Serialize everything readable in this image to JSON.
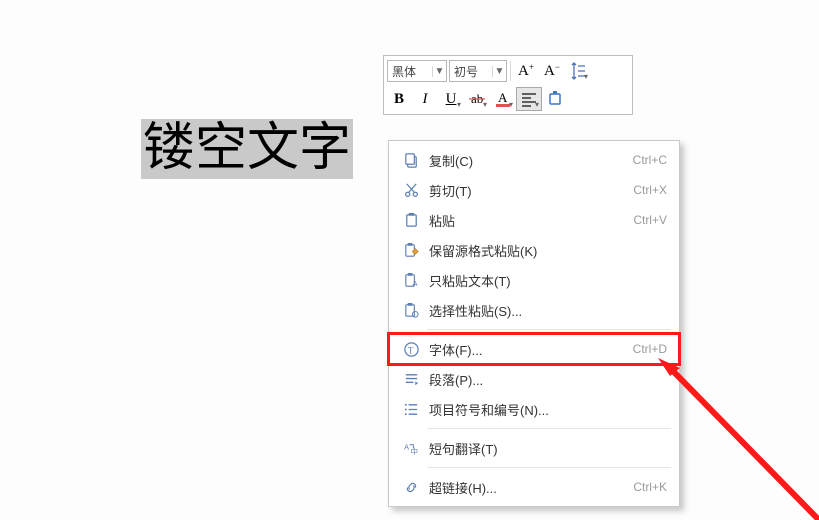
{
  "document": {
    "selected_text": "镂空文字"
  },
  "toolbar": {
    "font_name": "黑体",
    "font_size": "初号",
    "btn_increase_font": "A⁺",
    "btn_decrease_font": "A⁻",
    "btn_bold": "B",
    "btn_italic": "I",
    "btn_underline": "U"
  },
  "context_menu": {
    "copy": {
      "label": "复制(C)",
      "shortcut": "Ctrl+C"
    },
    "cut": {
      "label": "剪切(T)",
      "shortcut": "Ctrl+X"
    },
    "paste": {
      "label": "粘贴",
      "shortcut": "Ctrl+V"
    },
    "paste_keep": {
      "label": "保留源格式粘贴(K)",
      "shortcut": ""
    },
    "paste_text": {
      "label": "只粘贴文本(T)",
      "shortcut": ""
    },
    "paste_spec": {
      "label": "选择性粘贴(S)...",
      "shortcut": ""
    },
    "font": {
      "label": "字体(F)...",
      "shortcut": "Ctrl+D"
    },
    "paragraph": {
      "label": "段落(P)...",
      "shortcut": ""
    },
    "bullets": {
      "label": "项目符号和编号(N)...",
      "shortcut": ""
    },
    "translate": {
      "label": "短句翻译(T)",
      "shortcut": ""
    },
    "hyperlink": {
      "label": "超链接(H)...",
      "shortcut": "Ctrl+K"
    }
  }
}
